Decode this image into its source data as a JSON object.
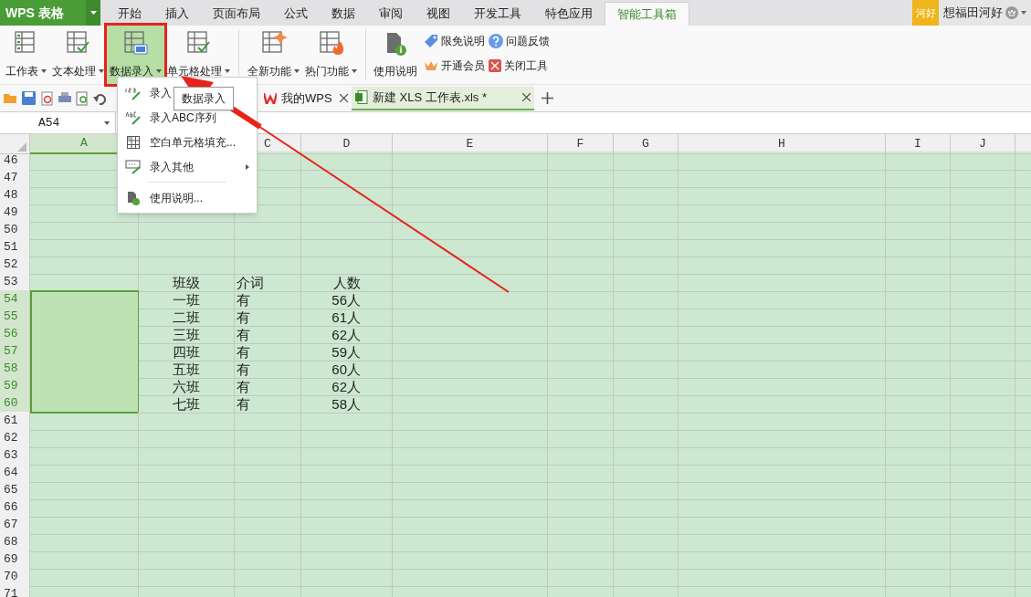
{
  "app": {
    "logo": "WPS 表格"
  },
  "tabs": [
    {
      "label": "开始",
      "selected": false
    },
    {
      "label": "插入",
      "selected": false
    },
    {
      "label": "页面布局",
      "selected": false
    },
    {
      "label": "公式",
      "selected": false
    },
    {
      "label": "数据",
      "selected": false
    },
    {
      "label": "审阅",
      "selected": false
    },
    {
      "label": "视图",
      "selected": false
    },
    {
      "label": "开发工具",
      "selected": false
    },
    {
      "label": "特色应用",
      "selected": false
    },
    {
      "label": "智能工具箱",
      "selected": true
    }
  ],
  "user": {
    "badge": "河好",
    "name": "想福田河好"
  },
  "ribbon": [
    {
      "label": "工作表",
      "kind": "sheet",
      "selected": false
    },
    {
      "label": "文本处理",
      "kind": "text",
      "selected": false
    },
    {
      "label": "数据录入",
      "kind": "entry",
      "selected": true
    },
    {
      "label": "单元格处理",
      "kind": "cell",
      "selected": false
    },
    {
      "label": "全新功能",
      "kind": "new",
      "selected": false
    },
    {
      "label": "热门功能",
      "kind": "hot",
      "selected": false
    }
  ],
  "help": {
    "label": "使用说明"
  },
  "links": [
    {
      "label": "限免说明",
      "kind": "tag"
    },
    {
      "label": "问题反馈",
      "kind": "question"
    },
    {
      "label": "开通会员",
      "kind": "crown"
    },
    {
      "label": "关闭工具",
      "kind": "close"
    }
  ],
  "menu": {
    "items": [
      {
        "label": "录入",
        "kind": "numbers",
        "submenu": false
      },
      {
        "label": "录入ABC序列",
        "kind": "abc",
        "submenu": false
      },
      {
        "label": "空白单元格填充...",
        "kind": "grid",
        "submenu": false
      },
      {
        "label": "录入其他",
        "kind": "other",
        "submenu": true
      },
      {
        "label": "使用说明...",
        "kind": "doc",
        "submenu": false
      }
    ],
    "tooltip": "数据录入"
  },
  "doc_tabs": [
    {
      "label": "我的WPS",
      "kind": "wps",
      "selected": false
    },
    {
      "label": "新建 XLS 工作表.xls *",
      "kind": "xls",
      "selected": true
    }
  ],
  "name_box": "A54",
  "columns": [
    {
      "label": "A",
      "selected": true
    },
    {
      "label": "C",
      "selected": false
    },
    {
      "label": "D",
      "selected": false
    },
    {
      "label": "E",
      "selected": false
    },
    {
      "label": "F",
      "selected": false
    },
    {
      "label": "G",
      "selected": false
    },
    {
      "label": "H",
      "selected": false
    },
    {
      "label": "I",
      "selected": false
    },
    {
      "label": "J",
      "selected": false
    }
  ],
  "rows": [
    {
      "n": "46",
      "selected": false
    },
    {
      "n": "47",
      "selected": false
    },
    {
      "n": "48",
      "selected": false
    },
    {
      "n": "49",
      "selected": false
    },
    {
      "n": "50",
      "selected": false
    },
    {
      "n": "51",
      "selected": false
    },
    {
      "n": "52",
      "selected": false
    },
    {
      "n": "53",
      "selected": false,
      "cells": [
        "班级",
        "介词",
        "人数"
      ]
    },
    {
      "n": "54",
      "selected": true,
      "cells": [
        "一班",
        "有",
        "56人"
      ]
    },
    {
      "n": "55",
      "selected": true,
      "cells": [
        "二班",
        "有",
        "61人"
      ]
    },
    {
      "n": "56",
      "selected": true,
      "cells": [
        "三班",
        "有",
        "62人"
      ]
    },
    {
      "n": "57",
      "selected": true,
      "cells": [
        "四班",
        "有",
        "59人"
      ]
    },
    {
      "n": "58",
      "selected": true,
      "cells": [
        "五班",
        "有",
        "60人"
      ]
    },
    {
      "n": "59",
      "selected": true,
      "cells": [
        "六班",
        "有",
        "62人"
      ]
    },
    {
      "n": "60",
      "selected": true,
      "cells": [
        "七班",
        "有",
        "58人"
      ]
    },
    {
      "n": "61",
      "selected": false
    },
    {
      "n": "62",
      "selected": false
    },
    {
      "n": "63",
      "selected": false
    },
    {
      "n": "64",
      "selected": false
    },
    {
      "n": "65",
      "selected": false
    },
    {
      "n": "66",
      "selected": false
    },
    {
      "n": "67",
      "selected": false
    },
    {
      "n": "68",
      "selected": false
    },
    {
      "n": "69",
      "selected": false
    },
    {
      "n": "70",
      "selected": false
    },
    {
      "n": "71",
      "selected": false
    }
  ]
}
